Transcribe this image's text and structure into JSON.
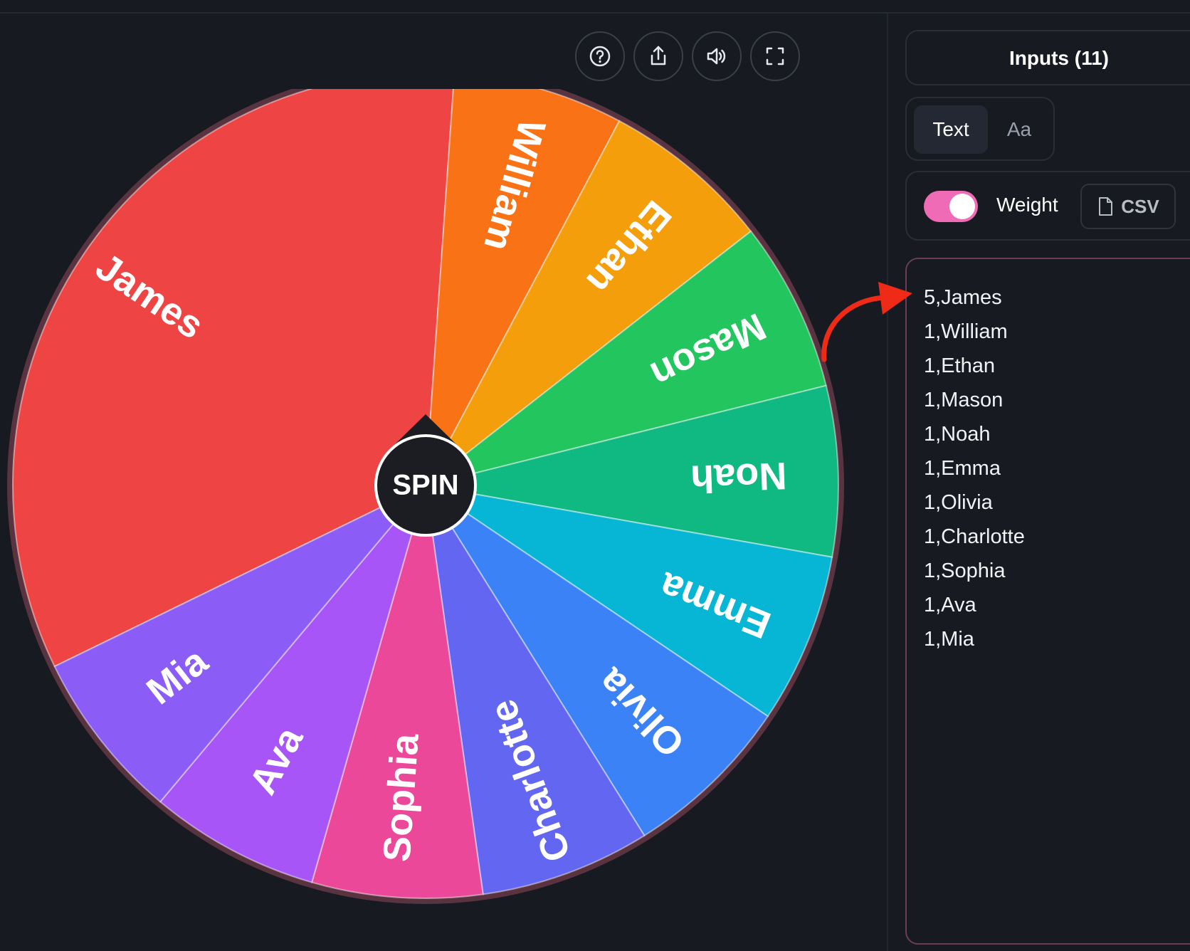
{
  "toolbar": {
    "buttons": [
      {
        "name": "help-button",
        "icon": "help-circle-icon"
      },
      {
        "name": "share-button",
        "icon": "share-icon"
      },
      {
        "name": "sound-button",
        "icon": "volume-icon"
      },
      {
        "name": "fullscreen-button",
        "icon": "fullscreen-icon"
      }
    ]
  },
  "wheel": {
    "spin_label": "SPIN",
    "segments": [
      {
        "label": "James",
        "weight": 5,
        "color": "#ef4444"
      },
      {
        "label": "William",
        "weight": 1,
        "color": "#f97316"
      },
      {
        "label": "Ethan",
        "weight": 1,
        "color": "#f59e0b"
      },
      {
        "label": "Mason",
        "weight": 1,
        "color": "#22c55e"
      },
      {
        "label": "Noah",
        "weight": 1,
        "color": "#10b981"
      },
      {
        "label": "Emma",
        "weight": 1,
        "color": "#06b6d4"
      },
      {
        "label": "Olivia",
        "weight": 1,
        "color": "#3b82f6"
      },
      {
        "label": "Charlotte",
        "weight": 1,
        "color": "#6366f1"
      },
      {
        "label": "Sophia",
        "weight": 1,
        "color": "#ec4899"
      },
      {
        "label": "Ava",
        "weight": 1,
        "color": "#a855f7"
      },
      {
        "label": "Mia",
        "weight": 1,
        "color": "#8b5cf6"
      }
    ]
  },
  "panel": {
    "inputs_title": "Inputs (11)",
    "tabs": [
      {
        "label": "Text",
        "active": true
      },
      {
        "label": "Aa",
        "active": false
      }
    ],
    "weight_toggle": {
      "label": "Weight",
      "on": true,
      "color": "#f06bb6"
    },
    "csv_button": {
      "label": "CSV",
      "icon": "file-icon"
    },
    "entries": [
      "5,James",
      "1,William",
      "1,Ethan",
      "1,Mason",
      "1,Noah",
      "1,Emma",
      "1,Olivia",
      "1,Charlotte",
      "1,Sophia",
      "1,Ava",
      "1,Mia"
    ]
  },
  "annotation": {
    "icon": "curved-arrow-icon",
    "color": "#ef2a17"
  }
}
